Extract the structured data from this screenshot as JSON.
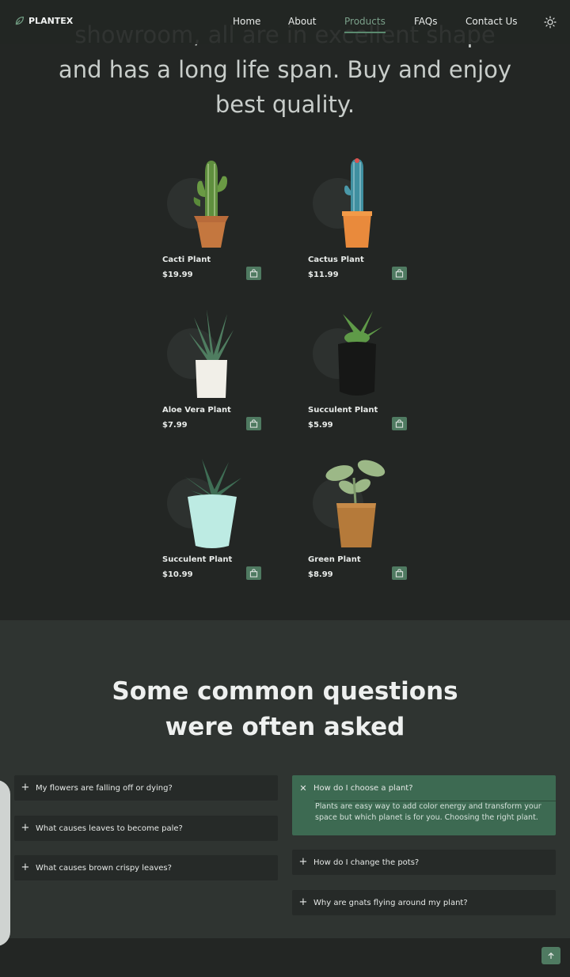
{
  "header": {
    "logo_text": "PLANTEX",
    "nav": [
      {
        "label": "Home"
      },
      {
        "label": "About"
      },
      {
        "label": "Products",
        "active": true
      },
      {
        "label": "FAQs"
      },
      {
        "label": "Contact Us"
      }
    ],
    "theme_icon": "sun-icon"
  },
  "hero": {
    "lines": [
      "showroom, all are in excellent shape",
      "and has a long life span. Buy and enjoy",
      "best quality."
    ]
  },
  "products": [
    {
      "name": "Cacti Plant",
      "price": "$19.99",
      "image": "cacti-plant-image"
    },
    {
      "name": "Cactus Plant",
      "price": "$11.99",
      "image": "cactus-plant-image"
    },
    {
      "name": "Aloe Vera Plant",
      "price": "$7.99",
      "image": "aloe-vera-plant-image"
    },
    {
      "name": "Succulent Plant",
      "price": "$5.99",
      "image": "succulent-plant-black-pot-image"
    },
    {
      "name": "Succulent Plant",
      "price": "$10.99",
      "image": "succulent-plant-mint-pot-image"
    },
    {
      "name": "Green Plant",
      "price": "$8.99",
      "image": "green-plant-image"
    }
  ],
  "faq": {
    "title_lines": [
      "Some common questions",
      "were often asked"
    ],
    "left": [
      {
        "question": "My flowers are falling off or dying?"
      },
      {
        "question": "What causes leaves to become pale?"
      },
      {
        "question": "What causes brown crispy leaves?"
      }
    ],
    "right": [
      {
        "question": "How do I choose a plant?",
        "open": true,
        "answer": "Plants are easy way to add color energy and transform your space but which planet is for you. Choosing the right plant."
      },
      {
        "question": "How do I change the pots?"
      },
      {
        "question": "Why are gnats flying around my plant?"
      }
    ]
  },
  "colors": {
    "background": "#232624",
    "faq_background": "#2f3431",
    "accent": "#4f7a61",
    "active_nav": "#7ba08a"
  }
}
